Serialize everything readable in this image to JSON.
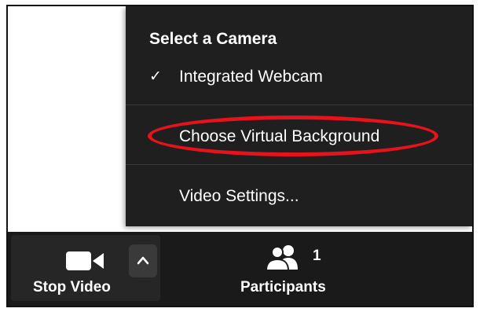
{
  "camera_menu": {
    "header": "Select a Camera",
    "items": [
      {
        "label": "Integrated Webcam",
        "checked": true,
        "icon": "checkmark-icon"
      },
      {
        "label": "Choose Virtual Background",
        "highlighted": true
      },
      {
        "label": "Video Settings..."
      }
    ]
  },
  "toolbar": {
    "stop_video": {
      "label": "Stop Video",
      "icon": "video-camera-icon"
    },
    "video_options": {
      "icon": "chevron-up-icon"
    },
    "participants": {
      "label": "Participants",
      "count": "1",
      "icon": "participants-icon"
    }
  },
  "colors": {
    "menu_background": "#1f1f1f",
    "toolbar_background": "#1a1a1a",
    "highlight_ring": "#e8121c",
    "text": "#ffffff"
  }
}
